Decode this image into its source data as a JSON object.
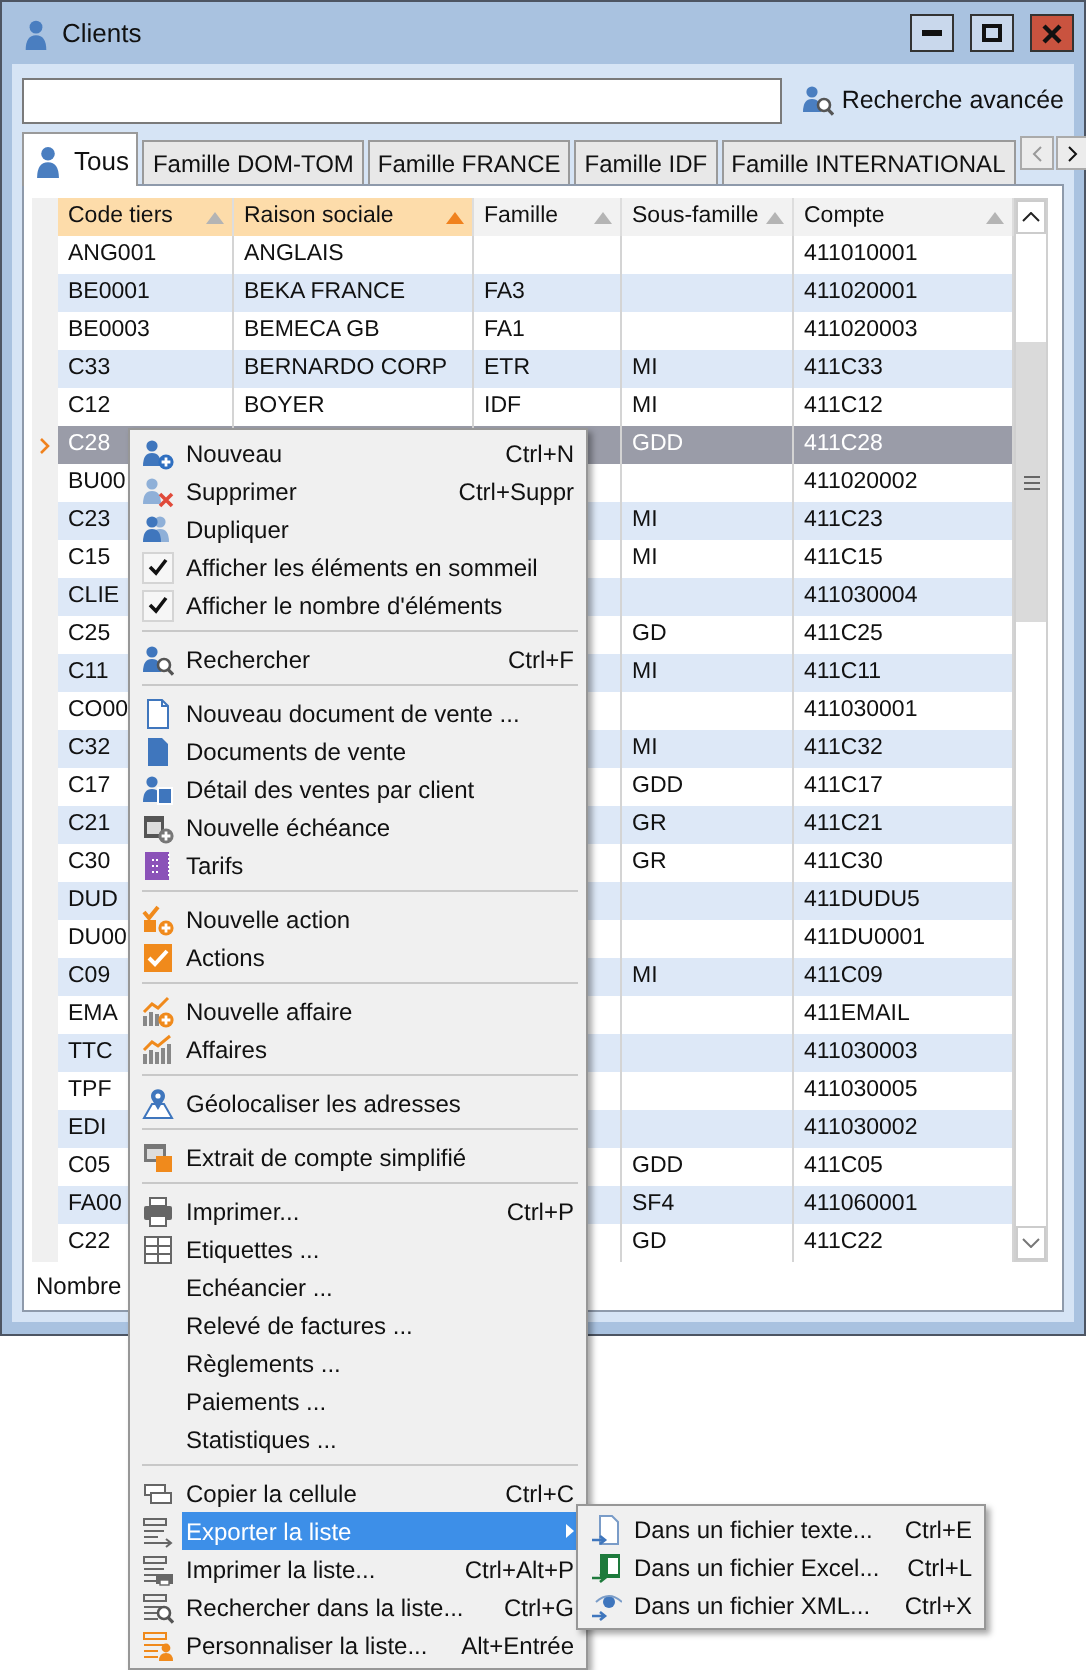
{
  "window": {
    "title": "Clients"
  },
  "search": {
    "button": "Recherche avancée"
  },
  "tabs": [
    {
      "label": "Tous",
      "selected": true
    },
    {
      "label": "Famille DOM-TOM",
      "selected": false
    },
    {
      "label": "Famille FRANCE",
      "selected": false
    },
    {
      "label": "Famille IDF",
      "selected": false
    },
    {
      "label": "Famille INTERNATIONAL",
      "selected": false
    }
  ],
  "table": {
    "columns": [
      {
        "label": "Code tiers",
        "highlighted": true,
        "sort_active": false
      },
      {
        "label": "Raison sociale",
        "highlighted": true,
        "sort_active": true
      },
      {
        "label": "Famille",
        "highlighted": false,
        "sort_active": false
      },
      {
        "label": "Sous-famille",
        "highlighted": false,
        "sort_active": false
      },
      {
        "label": "Compte",
        "highlighted": false,
        "sort_active": false
      }
    ],
    "rows": [
      {
        "code": "ANG001",
        "raison_sociale": "ANGLAIS",
        "compte": "411010001",
        "selected": false
      },
      {
        "code": "BE0001",
        "raison_sociale": "BEKA FRANCE",
        "famille": "FA3",
        "compte": "411020001",
        "selected": false
      },
      {
        "code": "BE0003",
        "raison_sociale": "BEMECA GB",
        "famille": "FA1",
        "compte": "411020003",
        "selected": false
      },
      {
        "code": "C33",
        "raison_sociale": "BERNARDO CORP",
        "famille": "ETR",
        "sous_famille": "MI",
        "compte": "411C33",
        "selected": false
      },
      {
        "code": "C12",
        "raison_sociale": "BOYER",
        "famille": "IDF",
        "sous_famille": "MI",
        "compte": "411C12",
        "selected": false
      },
      {
        "code": "C28",
        "sous_famille": "GDD",
        "compte": "411C28",
        "selected": true
      },
      {
        "code": "BU00",
        "compte": "411020002",
        "selected": false
      },
      {
        "code": "C23",
        "sous_famille": "MI",
        "compte": "411C23",
        "selected": false
      },
      {
        "code": "C15",
        "sous_famille": "MI",
        "compte": "411C15",
        "selected": false
      },
      {
        "code": "CLIE",
        "compte": "411030004",
        "selected": false
      },
      {
        "code": "C25",
        "sous_famille": "GD",
        "compte": "411C25",
        "selected": false
      },
      {
        "code": "C11",
        "sous_famille": "MI",
        "compte": "411C11",
        "selected": false
      },
      {
        "code": "CO00",
        "compte": "411030001",
        "selected": false
      },
      {
        "code": "C32",
        "sous_famille": "MI",
        "compte": "411C32",
        "selected": false
      },
      {
        "code": "C17",
        "sous_famille": "GDD",
        "compte": "411C17",
        "selected": false
      },
      {
        "code": "C21",
        "sous_famille": "GR",
        "compte": "411C21",
        "selected": false
      },
      {
        "code": "C30",
        "sous_famille": "GR",
        "compte": "411C30",
        "selected": false
      },
      {
        "code": "DUD",
        "compte": "411DUDU5",
        "selected": false
      },
      {
        "code": "DU00",
        "compte": "411DU0001",
        "selected": false
      },
      {
        "code": "C09",
        "sous_famille": "MI",
        "compte": "411C09",
        "selected": false
      },
      {
        "code": "EMA",
        "compte": "411EMAIL",
        "selected": false
      },
      {
        "code": "TTC",
        "compte": "411030003",
        "selected": false
      },
      {
        "code": "TPF",
        "compte": "411030005",
        "selected": false
      },
      {
        "code": "EDI",
        "compte": "411030002",
        "selected": false
      },
      {
        "code": "C05",
        "sous_famille": "GDD",
        "compte": "411C05",
        "selected": false
      },
      {
        "code": "FA00",
        "sous_famille": "SF4",
        "compte": "411060001",
        "selected": false
      },
      {
        "code": "C22",
        "sous_famille": "GD",
        "compte": "411C22",
        "selected": false
      }
    ]
  },
  "status_bar": {
    "text": "Nombre"
  },
  "context_menu": {
    "groups": [
      [
        {
          "kind": "icon",
          "label": "Nouveau",
          "shortcut": "Ctrl+N",
          "selected": false
        },
        {
          "kind": "icon",
          "label": "Supprimer",
          "shortcut": "Ctrl+Suppr",
          "selected": false
        },
        {
          "kind": "icon",
          "label": "Dupliquer",
          "selected": false
        },
        {
          "kind": "check",
          "label": "Afficher les éléments en sommeil",
          "checked": true,
          "selected": false
        },
        {
          "kind": "check",
          "label": "Afficher le nombre d'éléments",
          "checked": true,
          "selected": false
        }
      ],
      [
        {
          "kind": "icon",
          "label": "Rechercher",
          "shortcut": "Ctrl+F",
          "selected": false
        }
      ],
      [
        {
          "kind": "icon",
          "label": "Nouveau document de vente ...",
          "selected": false
        },
        {
          "kind": "icon",
          "label": "Documents de vente",
          "selected": false
        },
        {
          "kind": "icon",
          "label": "Détail des ventes par client",
          "selected": false
        },
        {
          "kind": "icon",
          "label": "Nouvelle échéance",
          "selected": false
        },
        {
          "kind": "icon",
          "label": "Tarifs",
          "selected": false
        }
      ],
      [
        {
          "kind": "icon",
          "label": "Nouvelle action",
          "selected": false
        },
        {
          "kind": "icon",
          "label": "Actions",
          "selected": false
        }
      ],
      [
        {
          "kind": "icon",
          "label": "Nouvelle affaire",
          "selected": false
        },
        {
          "kind": "icon",
          "label": "Affaires",
          "selected": false
        }
      ],
      [
        {
          "kind": "icon",
          "label": "Géolocaliser les adresses",
          "selected": false
        }
      ],
      [
        {
          "kind": "icon",
          "label": "Extrait de compte simplifié",
          "selected": false
        }
      ],
      [
        {
          "kind": "icon",
          "label": "Imprimer...",
          "shortcut": "Ctrl+P",
          "selected": false
        },
        {
          "kind": "icon",
          "label": "Etiquettes ...",
          "selected": false
        },
        {
          "kind": "plain",
          "label": "Echéancier ...",
          "selected": false
        },
        {
          "kind": "plain",
          "label": "Relevé de factures ...",
          "selected": false
        },
        {
          "kind": "plain",
          "label": "Règlements ...",
          "selected": false
        },
        {
          "kind": "plain",
          "label": "Paiements ...",
          "selected": false
        },
        {
          "kind": "plain",
          "label": "Statistiques ...",
          "selected": false
        }
      ],
      [
        {
          "kind": "icon",
          "label": "Copier la cellule",
          "shortcut": "Ctrl+C",
          "selected": false
        },
        {
          "kind": "icon",
          "label": "Exporter la liste",
          "submenu": true,
          "selected": true
        },
        {
          "kind": "icon",
          "label": "Imprimer la liste...",
          "shortcut": "Ctrl+Alt+P",
          "selected": false
        },
        {
          "kind": "icon",
          "label": "Rechercher dans la liste...",
          "shortcut": "Ctrl+G",
          "selected": false
        },
        {
          "kind": "icon",
          "label": "Personnaliser la liste...",
          "shortcut": "Alt+Entrée",
          "selected": false
        }
      ]
    ]
  },
  "submenu": {
    "items": [
      {
        "label": "Dans un fichier texte...",
        "shortcut": "Ctrl+E",
        "selected": false
      },
      {
        "label": "Dans un fichier Excel...",
        "shortcut": "Ctrl+L",
        "selected": false
      },
      {
        "label": "Dans un fichier XML...",
        "shortcut": "Ctrl+X",
        "selected": false
      }
    ]
  }
}
